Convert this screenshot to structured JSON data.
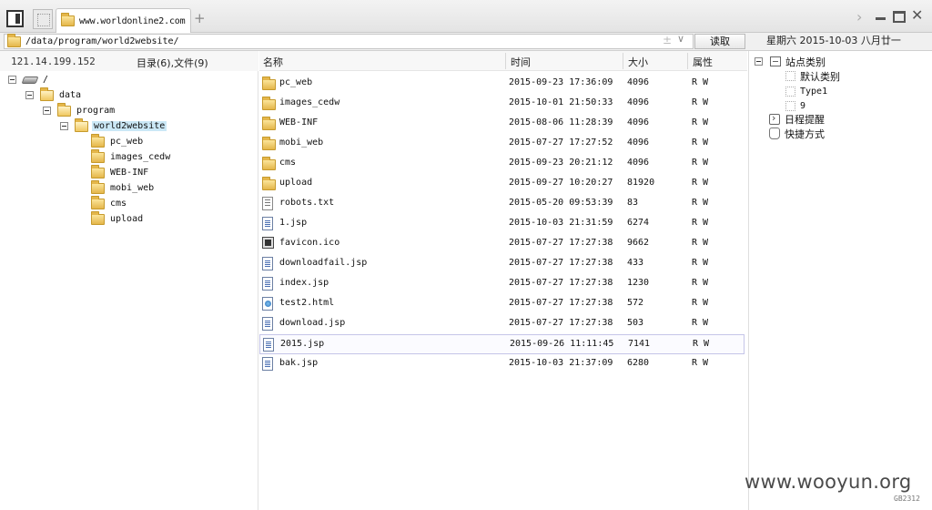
{
  "tab": {
    "label": "www.worldonline2.com"
  },
  "address": {
    "path": "/data/program/world2website/",
    "read_label": "读取"
  },
  "date_display": "星期六 2015-10-03 八月廿一",
  "info": {
    "server_ip": "121.14.199.152",
    "dir_count": "目录(6),文件(9)"
  },
  "tree": {
    "root": "/",
    "data": "data",
    "program": "program",
    "website": "world2website",
    "children": [
      "pc_web",
      "images_cedw",
      "WEB-INF",
      "mobi_web",
      "cms",
      "upload"
    ]
  },
  "columns": {
    "name": "名称",
    "time": "时间",
    "size": "大小",
    "attr": "属性"
  },
  "files": [
    {
      "name": "pc_web",
      "time": "2015-09-23 17:36:09",
      "size": "4096",
      "attr": "R W",
      "type": "folder"
    },
    {
      "name": "images_cedw",
      "time": "2015-10-01 21:50:33",
      "size": "4096",
      "attr": "R W",
      "type": "folder"
    },
    {
      "name": "WEB-INF",
      "time": "2015-08-06 11:28:39",
      "size": "4096",
      "attr": "R W",
      "type": "folder"
    },
    {
      "name": "mobi_web",
      "time": "2015-07-27 17:27:52",
      "size": "4096",
      "attr": "R W",
      "type": "folder"
    },
    {
      "name": "cms",
      "time": "2015-09-23 20:21:12",
      "size": "4096",
      "attr": "R W",
      "type": "folder"
    },
    {
      "name": "upload",
      "time": "2015-09-27 10:20:27",
      "size": "81920",
      "attr": "R W",
      "type": "folder"
    },
    {
      "name": "robots.txt",
      "time": "2015-05-20 09:53:39",
      "size": "83",
      "attr": "R W",
      "type": "txt"
    },
    {
      "name": "1.jsp",
      "time": "2015-10-03 21:31:59",
      "size": "6274",
      "attr": "R W",
      "type": "jsp"
    },
    {
      "name": "favicon.ico",
      "time": "2015-07-27 17:27:38",
      "size": "9662",
      "attr": "R W",
      "type": "ico"
    },
    {
      "name": "downloadfail.jsp",
      "time": "2015-07-27 17:27:38",
      "size": "433",
      "attr": "R W",
      "type": "jsp"
    },
    {
      "name": "index.jsp",
      "time": "2015-07-27 17:27:38",
      "size": "1230",
      "attr": "R W",
      "type": "jsp"
    },
    {
      "name": "test2.html",
      "time": "2015-07-27 17:27:38",
      "size": "572",
      "attr": "R W",
      "type": "html"
    },
    {
      "name": "download.jsp",
      "time": "2015-07-27 17:27:38",
      "size": "503",
      "attr": "R W",
      "type": "jsp"
    },
    {
      "name": "2015.jsp",
      "time": "2015-09-26 11:11:45",
      "size": "7141",
      "attr": "R W",
      "type": "jsp"
    },
    {
      "name": "bak.jsp",
      "time": "2015-10-03 21:37:09",
      "size": "6280",
      "attr": "R W",
      "type": "jsp"
    }
  ],
  "right_panel": {
    "site_category": "站点类别",
    "categories": [
      "默认类别",
      "Type1",
      "9"
    ],
    "schedule": "日程提醒",
    "shortcuts": "快捷方式"
  },
  "watermark": "www.wooyun.org",
  "encoding": "GB2312"
}
